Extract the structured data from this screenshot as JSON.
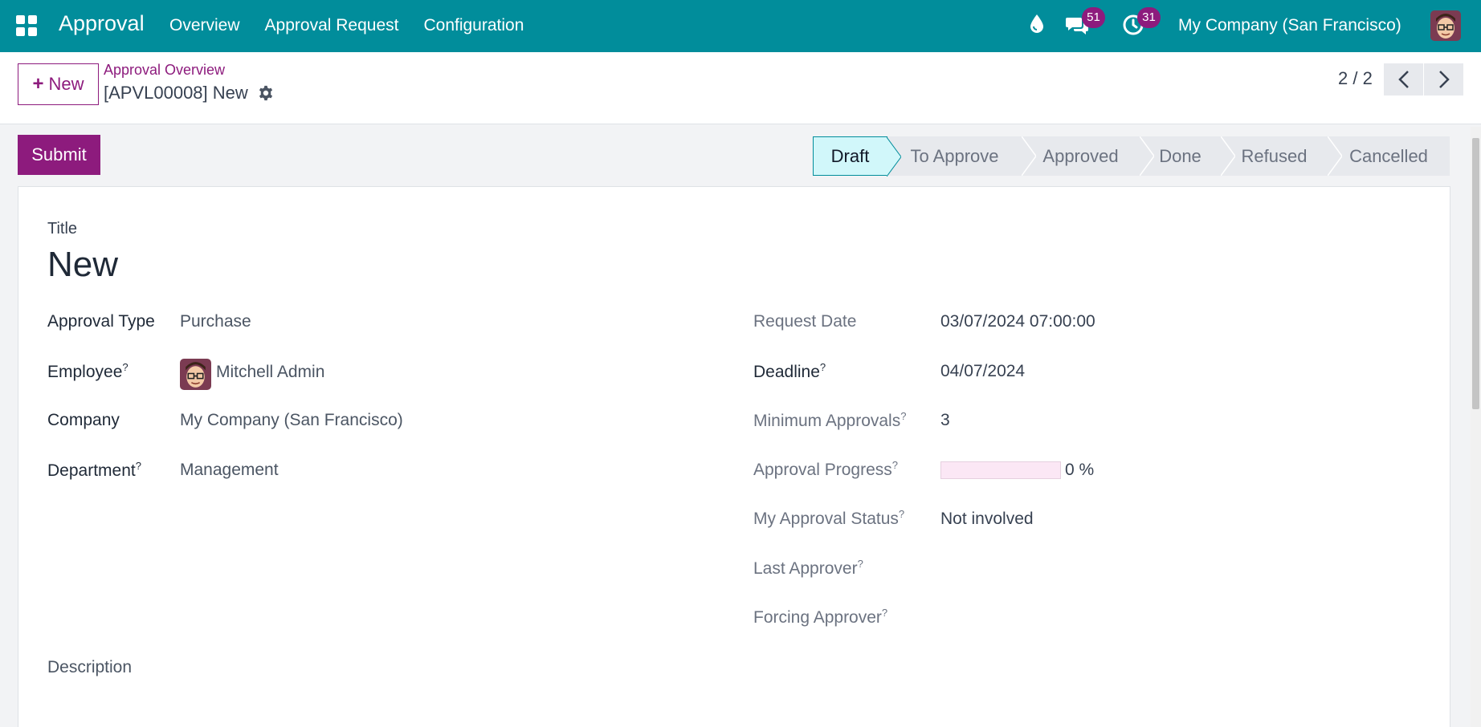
{
  "navbar": {
    "app_name": "Approval",
    "menu": [
      "Overview",
      "Approval Request",
      "Configuration"
    ],
    "chat_count": "51",
    "activity_count": "31",
    "company": "My Company (San Francisco)",
    "icons": [
      "apps-grid-icon",
      "drop-icon",
      "chat-icon",
      "clock-icon",
      "user-avatar"
    ]
  },
  "control_panel": {
    "new_label": "New",
    "breadcrumb": "Approval Overview",
    "record_name": "[APVL00008] New",
    "pager": "2 / 2"
  },
  "actions": {
    "submit_label": "Submit"
  },
  "statusbar": {
    "stages": [
      "Draft",
      "To Approve",
      "Approved",
      "Done",
      "Refused",
      "Cancelled"
    ],
    "active": "Draft"
  },
  "form": {
    "title_label": "Title",
    "title_value": "New",
    "left": {
      "approval_type_label": "Approval Type",
      "approval_type_value": "Purchase",
      "employee_label": "Employee",
      "employee_value": "Mitchell Admin",
      "company_label": "Company",
      "company_value": "My Company (San Francisco)",
      "department_label": "Department",
      "department_value": "Management"
    },
    "right": {
      "request_date_label": "Request Date",
      "request_date_value": "03/07/2024 07:00:00",
      "deadline_label": "Deadline",
      "deadline_value": "04/07/2024",
      "min_approvals_label": "Minimum Approvals",
      "min_approvals_value": "3",
      "approval_progress_label": "Approval Progress",
      "approval_progress_value": 0,
      "approval_progress_text": "0 %",
      "my_status_label": "My Approval Status",
      "my_status_value": "Not involved",
      "last_approver_label": "Last Approver",
      "forcing_approver_label": "Forcing Approver"
    },
    "description_label": "Description",
    "help_mark": "?"
  },
  "colors": {
    "navbar": "#018d9b",
    "primary": "#8d1b7d",
    "active_stage": "#d1f7fa"
  }
}
